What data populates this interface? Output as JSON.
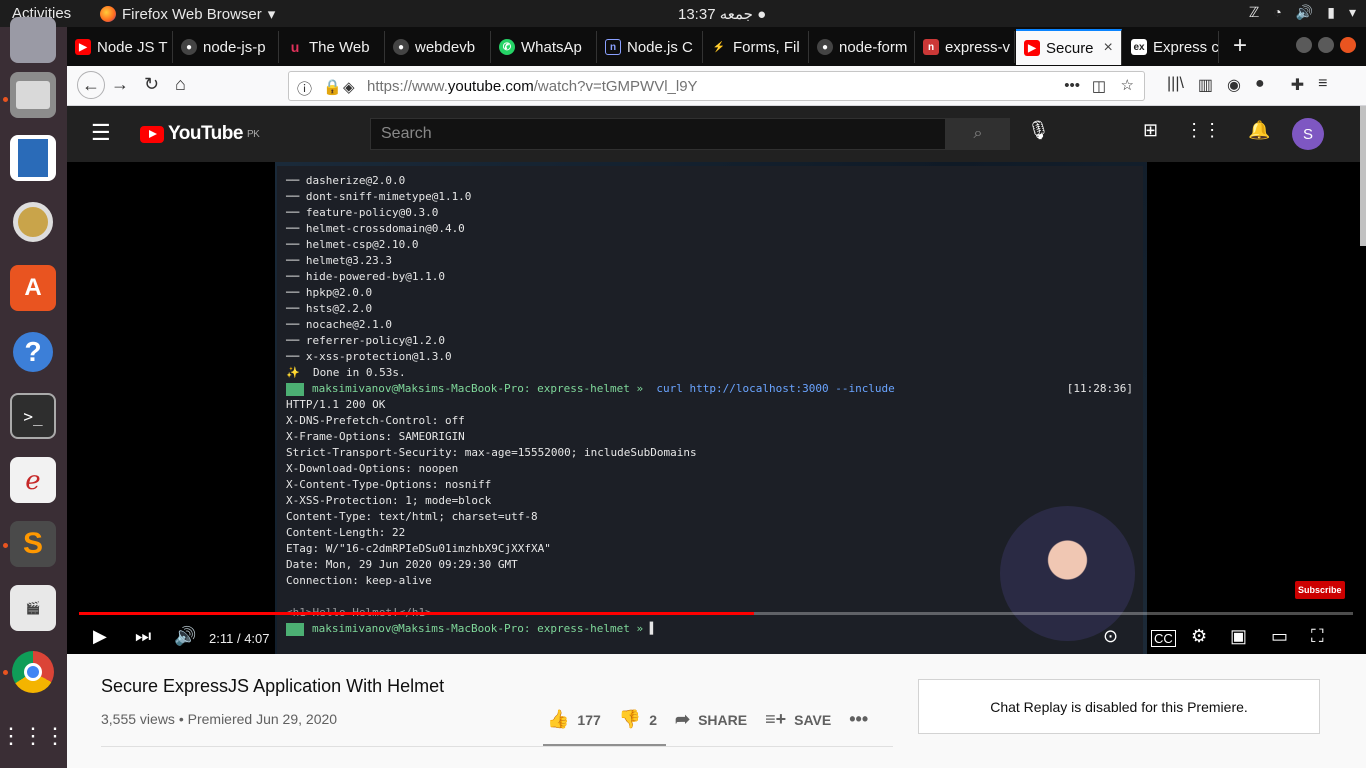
{
  "topbar": {
    "activities": "Activities",
    "app_name": "Firefox Web Browser",
    "clock": "13:37 جمعه ●"
  },
  "tabs": [
    {
      "label": "Node JS T",
      "favicon": "youtube-icon",
      "color": "#ff0000"
    },
    {
      "label": "node-js-p",
      "favicon": "github-icon",
      "color": "#24292e"
    },
    {
      "label": "The Web",
      "favicon": "udemy-icon",
      "color": "#b5133b"
    },
    {
      "label": "webdevb",
      "favicon": "github-icon",
      "color": "#24292e"
    },
    {
      "label": "WhatsAp",
      "favicon": "whatsapp-icon",
      "color": "#25d366"
    },
    {
      "label": "Node.js C",
      "favicon": "nodejs-doc-icon",
      "color": "#5b7bd5"
    },
    {
      "label": "Forms, Fil",
      "favicon": "forms-icon",
      "color": "#222222"
    },
    {
      "label": "node-form",
      "favicon": "github-icon",
      "color": "#24292e"
    },
    {
      "label": "express-v",
      "favicon": "npm-icon",
      "color": "#cb3837"
    },
    {
      "label": "Secure",
      "favicon": "youtube-icon",
      "color": "#ff0000",
      "active": true
    },
    {
      "label": "Express c",
      "favicon": "ex-icon",
      "color": "#333333"
    }
  ],
  "navbar": {
    "url_prefix": "https://www.",
    "url_domain": "youtube.com",
    "url_path": "/watch?v=tGMPWVl_l9Y"
  },
  "youtube": {
    "region": "PK",
    "search_placeholder": "Search",
    "avatar_letter": "S",
    "video": {
      "current_time": "2:11",
      "duration": "4:07",
      "progress": 0.53,
      "subscribe_label": "Subscribe",
      "title": "Secure ExpressJS Application With Helmet",
      "views": "3,555 views",
      "premiered": "Premiered Jun 29, 2020",
      "likes": "177",
      "dislikes": "2",
      "share_label": "SHARE",
      "save_label": "SAVE"
    },
    "chat_replay": "Chat Replay is disabled for this Premiere."
  },
  "terminal": {
    "deps": [
      "── dasherize@2.0.0",
      "── dont-sniff-mimetype@1.1.0",
      "── feature-policy@0.3.0",
      "── helmet-crossdomain@0.4.0",
      "── helmet-csp@2.10.0",
      "── helmet@3.23.3",
      "── hide-powered-by@1.1.0",
      "── hpkp@2.0.0",
      "── hsts@2.2.0",
      "── nocache@2.1.0",
      "── referrer-policy@1.2.0",
      "── x-xss-protection@1.3.0"
    ],
    "done": "✨  Done in 0.53s.",
    "prompt_user": "maksimivanov@Maksims-MacBook-Pro: express-helmet »",
    "command": "curl http://localhost:3000 --include",
    "prompt_time": "[11:28:36]",
    "headers": [
      "HTTP/1.1 200 OK",
      "X-DNS-Prefetch-Control: off",
      "X-Frame-Options: SAMEORIGIN",
      "Strict-Transport-Security: max-age=15552000; includeSubDomains",
      "X-Download-Options: noopen",
      "X-Content-Type-Options: nosniff",
      "X-XSS-Protection: 1; mode=block",
      "Content-Type: text/html; charset=utf-8",
      "Content-Length: 22",
      "ETag: W/\"16-c2dmRPIeDSu01imzhbX9CjXXfXA\"",
      "Date: Mon, 29 Jun 2020 09:29:30 GMT",
      "Connection: keep-alive"
    ],
    "body": "<h1>Hello Helmet!</h1>",
    "final_prompt": "maksimivanov@Maksims-MacBook-Pro: express-helmet »"
  }
}
